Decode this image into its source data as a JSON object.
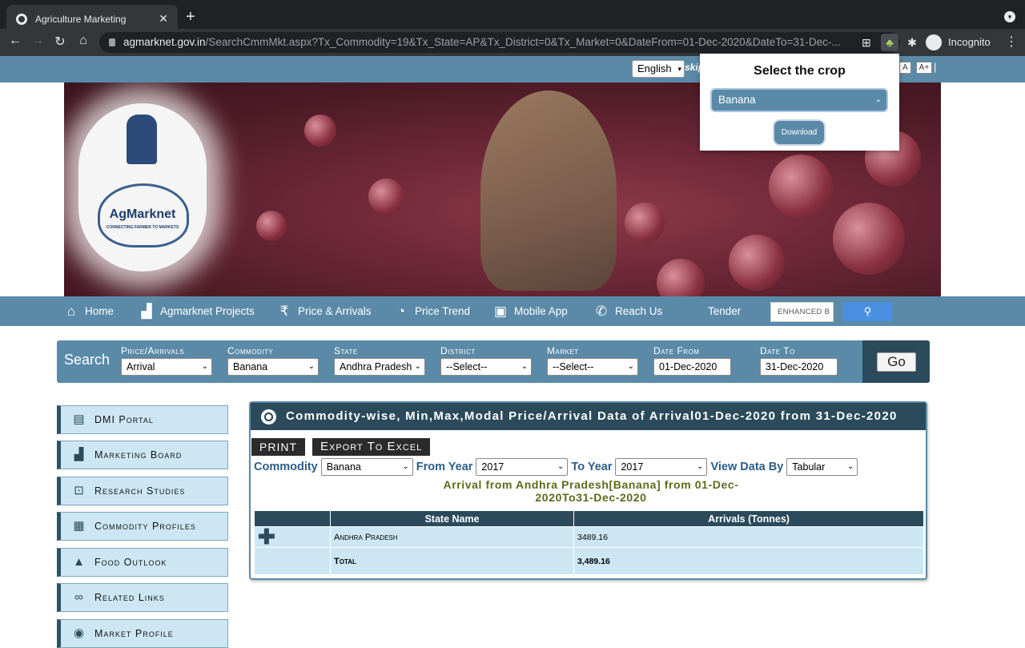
{
  "browser": {
    "tab_title": "Agriculture Marketing",
    "url_host": "agmarknet.gov.in",
    "url_path": "/SearchCmmMkt.aspx?Tx_Commodity=19&Tx_State=AP&Tx_District=0&Tx_Market=0&DateFrom=01-Dec-2020&DateTo=31-Dec-...",
    "profile_label": "Incognito"
  },
  "topbar": {
    "language": "English",
    "skip_text": "skip",
    "font_small": "A",
    "font_large": "A+",
    "separator": "|"
  },
  "banner": {
    "logo_text": "AgMarknet",
    "logo_subtext": "CONNECTING FARMER TO MARKETS"
  },
  "nav": {
    "items": [
      {
        "label": "Home",
        "icon": "home-icon"
      },
      {
        "label": "Agmarknet Projects",
        "icon": "chart-icon"
      },
      {
        "label": "Price & Arrivals",
        "icon": "rupee-icon"
      },
      {
        "label": "Price Trend",
        "icon": "trend-icon"
      },
      {
        "label": "Mobile App",
        "icon": "android-icon"
      },
      {
        "label": "Reach Us",
        "icon": "phone-icon"
      },
      {
        "label": "Tender",
        "icon": ""
      }
    ],
    "search_placeholder": "ENHANCED B",
    "search_button_icon": "search-icon"
  },
  "search": {
    "label": "Search",
    "fields": [
      {
        "label": "Price/Arrivals",
        "value": "Arrival"
      },
      {
        "label": "Commodity",
        "value": "Banana"
      },
      {
        "label": "State",
        "value": "Andhra Pradesh"
      },
      {
        "label": "District",
        "value": "--Select--"
      },
      {
        "label": "Market",
        "value": "--Select--"
      },
      {
        "label": "Date From",
        "value": "01-Dec-2020"
      },
      {
        "label": "Date To",
        "value": "31-Dec-2020"
      }
    ],
    "go_label": "Go"
  },
  "sidebar": {
    "items": [
      {
        "label": "DMI Portal",
        "icon": "chat-icon"
      },
      {
        "label": "Marketing Board",
        "icon": "bar-chart-icon"
      },
      {
        "label": "Research Studies",
        "icon": "magnifier-chart-icon"
      },
      {
        "label": "Commodity Profiles",
        "icon": "box-icon"
      },
      {
        "label": "Food Outlook",
        "icon": "food-icon"
      },
      {
        "label": "Related Links",
        "icon": "link-icon"
      },
      {
        "label": "Market Profile",
        "icon": "market-icon"
      }
    ]
  },
  "panel": {
    "title": "Commodity-wise, Min,Max,Modal Price/Arrival Data of Arrival01-Dec-2020 from 31-Dec-2020",
    "print_label": "PRINT",
    "export_label": "Export To Excel",
    "commodity_label": "Commodity",
    "commodity_value": "Banana",
    "from_year_label": "From Year",
    "from_year_value": "2017",
    "to_year_label": "To Year",
    "to_year_value": "2017",
    "view_by_label": "View Data By",
    "view_by_value": "Tabular",
    "caption_line1": "Arrival from Andhra Pradesh[Banana] from 01-Dec-",
    "caption_line2": "2020To31-Dec-2020",
    "table": {
      "headers": [
        "",
        "State Name",
        "Arrivals (Tonnes)"
      ],
      "rows": [
        {
          "state": "Andhra Pradesh",
          "arrivals": "3489.16"
        },
        {
          "state": "Total",
          "arrivals": "3,489.16"
        }
      ]
    }
  },
  "popup": {
    "heading": "Select the crop",
    "crop_value": "Banana",
    "download_label": "Download"
  }
}
